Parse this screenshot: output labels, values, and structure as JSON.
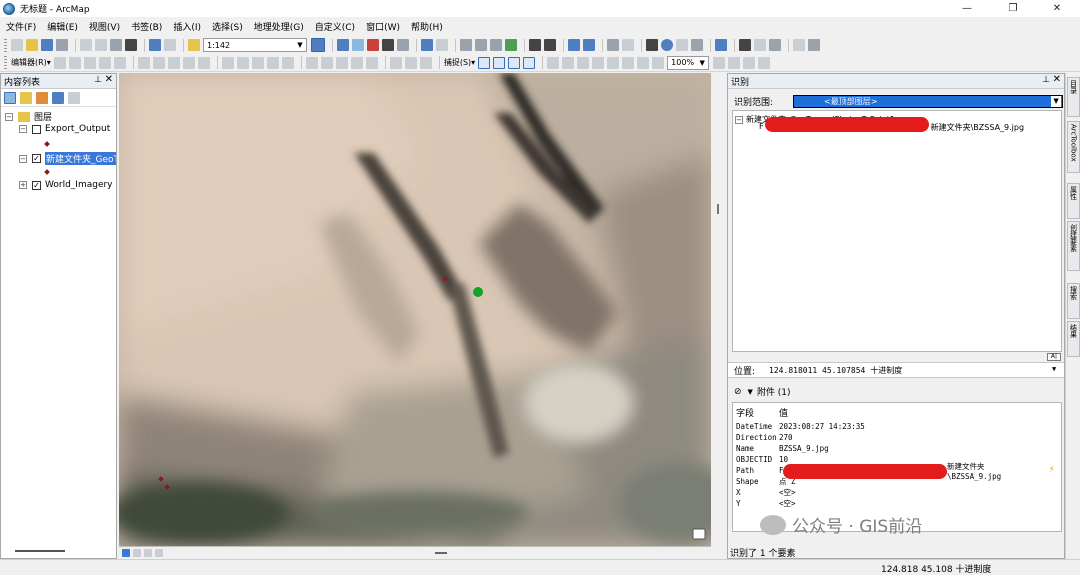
{
  "window": {
    "title": "无标题 - ArcMap",
    "min": "—",
    "max": "❐",
    "close": "✕"
  },
  "menu": [
    "文件(F)",
    "编辑(E)",
    "视图(V)",
    "书签(B)",
    "插入(I)",
    "选择(S)",
    "地理处理(G)",
    "自定义(C)",
    "窗口(W)",
    "帮助(H)"
  ],
  "toolbar": {
    "scale": "1:142",
    "editor_label": "编辑器(R)▾",
    "snap_label": "捕捉(S)▾",
    "zoom_level": "100%"
  },
  "toc": {
    "title": "内容列表",
    "root": "图层",
    "layers": [
      {
        "name": "Export_Output",
        "checked": false,
        "expanded": true
      },
      {
        "name": "新建文件夹_GeoT",
        "checked": true,
        "expanded": true,
        "selected": true
      },
      {
        "name": "World_Imagery",
        "checked": true,
        "expanded": false
      }
    ]
  },
  "identify": {
    "title": "识别",
    "scope_label": "识别范围:",
    "scope_value": "<最顶部图层>",
    "tree_layer": "新建文件夹_GeoTaggedPhotosToPoint1",
    "tree_feature_prefix": "F",
    "tree_feature_suffix": "新建文件夹\\BZSSA_9.jpg",
    "location_label": "位置:",
    "location_value": "124.818011  45.107854 十进制度",
    "attachments": "附件 (1)",
    "field_header": "字段",
    "value_header": "值",
    "rows": [
      {
        "field": "DateTime",
        "value": "2023:08:27 14:23:35"
      },
      {
        "field": "Direction",
        "value": "270"
      },
      {
        "field": "Name",
        "value": "BZSSA_9.jpg"
      },
      {
        "field": "OBJECTID",
        "value": "10"
      },
      {
        "field": "Path",
        "value": "F"
      },
      {
        "field": "Shape",
        "value": "点 Z"
      },
      {
        "field": "X",
        "value": "<空>"
      },
      {
        "field": "Y",
        "value": "<空>"
      }
    ],
    "path_suffix": "新建文件夹\\BZSSA_9.jpg",
    "footer": "识别了 1 个要素"
  },
  "right_tabs": [
    "目录",
    "ArcToolbox",
    "属性",
    "创建要素",
    "搜索",
    "结果"
  ],
  "status": {
    "coords": "124.818  45.108 十进制度"
  },
  "watermark": "公众号 · GIS前沿",
  "colors": {
    "selected_layer": "#3a78d8",
    "point_green": "#14a02a",
    "redaction": "#e41b1b",
    "symbol": "#8b1a1a"
  }
}
